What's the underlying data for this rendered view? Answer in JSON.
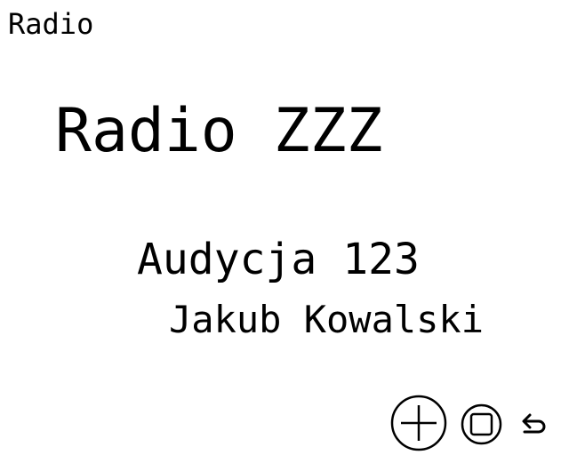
{
  "header": {
    "app_title": "Radio"
  },
  "station": {
    "name": "Radio ZZZ"
  },
  "now_playing": {
    "program": "Audycja 123",
    "host": "Jakub Kowalski"
  },
  "controls": {
    "add_icon": "plus-circle-icon",
    "stop_icon": "stop-square-icon",
    "back_icon": "return-arrow-icon"
  },
  "colors": {
    "background": "#ffffff",
    "foreground": "#000000"
  }
}
